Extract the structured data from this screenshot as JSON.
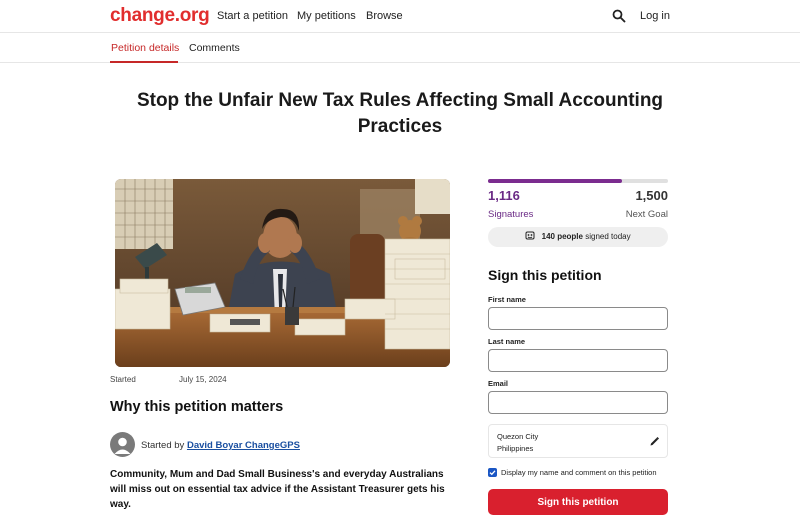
{
  "brand": {
    "logo_text": "change.org",
    "accent": "#e12d2d"
  },
  "nav": {
    "start": "Start a petition",
    "my": "My petitions",
    "browse": "Browse",
    "login": "Log in",
    "search_icon": "search-icon"
  },
  "tabs": [
    {
      "label": "Petition details",
      "active": true
    },
    {
      "label": "Comments",
      "active": false
    }
  ],
  "petition": {
    "title": "Stop the Unfair New Tax Rules Affecting Small Accounting Practices",
    "started_label": "Started",
    "started_date": "July 15, 2024",
    "why_heading": "Why this petition matters",
    "started_by_prefix": "Started by",
    "author": "David Boyar ChangeGPS",
    "body": "Community, Mum and Dad Small Business's and everyday Australians will miss out on essential tax advice if the Assistant Treasurer gets his way."
  },
  "progress": {
    "signatures": "1,116",
    "signatures_label": "Signatures",
    "goal": "1,500",
    "goal_label": "Next Goal",
    "fraction": 0.744,
    "today_count": "140 people",
    "today_suffix": "signed today",
    "bar_color": "#7b2c8f"
  },
  "form": {
    "heading": "Sign this petition",
    "first_name_label": "First name",
    "first_name_value": "",
    "last_name_label": "Last name",
    "last_name_value": "",
    "email_label": "Email",
    "email_value": "",
    "location_city": "Quezon City",
    "location_country": "Philippines",
    "display_checkbox_label": "Display my name and comment on this petition",
    "display_checked": true,
    "submit_label": "Sign this petition",
    "submit_color": "#d9202e"
  }
}
